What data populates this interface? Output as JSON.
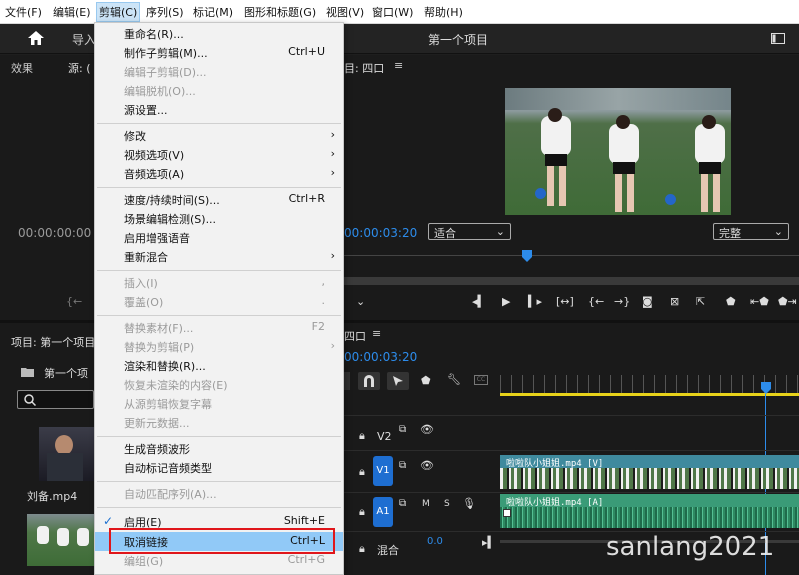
{
  "menubar": [
    "文件(F)",
    "编辑(E)",
    "剪辑(C)",
    "序列(S)",
    "标记(M)",
    "图形和标题(G)",
    "视图(V)",
    "窗口(W)",
    "帮助(H)"
  ],
  "topbar": {
    "import_label": "导入",
    "project_title": "第一个项目"
  },
  "panels": {
    "effects_label": "效果",
    "source_label": "源: (",
    "program_label": "目: 四口",
    "source_timecode": "00:00:00:00",
    "program_timecode": "00:00:03:20",
    "fit_label": "适合",
    "quality_label": "完整",
    "project_label": "项目: 第一个项目",
    "project_folder": "第一个项",
    "clip_name": "刘备.mp4",
    "timeline_seq": "四口",
    "timeline_timecode": "00:00:03:20"
  },
  "tracks": {
    "v2": "V2",
    "v1": "V1",
    "a1": "A1",
    "mix_label": "混合",
    "mix_value": "0.0",
    "m_label": "M",
    "s_label": "S",
    "video_clip": "啦啦队小姐姐.mp4 [V]",
    "audio_clip": "啦啦队小姐姐.mp4 [A]"
  },
  "menu": {
    "items": [
      {
        "label": "重命名(R)...",
        "shortcut": "",
        "disabled": false,
        "submenu": false
      },
      {
        "label": "制作子剪辑(M)...",
        "shortcut": "Ctrl+U",
        "disabled": false,
        "submenu": false
      },
      {
        "label": "编辑子剪辑(D)...",
        "shortcut": "",
        "disabled": true,
        "submenu": false
      },
      {
        "label": "编辑脱机(O)...",
        "shortcut": "",
        "disabled": true,
        "submenu": false
      },
      {
        "label": "源设置...",
        "shortcut": "",
        "disabled": false,
        "submenu": false
      },
      {
        "label": "修改",
        "shortcut": "",
        "disabled": false,
        "submenu": true
      },
      {
        "label": "视频选项(V)",
        "shortcut": "",
        "disabled": false,
        "submenu": true
      },
      {
        "label": "音频选项(A)",
        "shortcut": "",
        "disabled": false,
        "submenu": true
      },
      {
        "label": "速度/持续时间(S)...",
        "shortcut": "Ctrl+R",
        "disabled": false,
        "submenu": false
      },
      {
        "label": "场景编辑检测(S)...",
        "shortcut": "",
        "disabled": false,
        "submenu": false
      },
      {
        "label": "启用增强语音",
        "shortcut": "",
        "disabled": false,
        "submenu": false
      },
      {
        "label": "重新混合",
        "shortcut": "",
        "disabled": false,
        "submenu": true
      },
      {
        "label": "插入(I)",
        "shortcut": ",",
        "disabled": true,
        "submenu": false
      },
      {
        "label": "覆盖(O)",
        "shortcut": ".",
        "disabled": true,
        "submenu": false
      },
      {
        "label": "替换素材(F)...",
        "shortcut": "F2",
        "disabled": true,
        "submenu": false
      },
      {
        "label": "替换为剪辑(P)",
        "shortcut": "",
        "disabled": true,
        "submenu": true
      },
      {
        "label": "渲染和替换(R)...",
        "shortcut": "",
        "disabled": false,
        "submenu": false
      },
      {
        "label": "恢复未渲染的内容(E)",
        "shortcut": "",
        "disabled": true,
        "submenu": false
      },
      {
        "label": "从源剪辑恢复字幕",
        "shortcut": "",
        "disabled": true,
        "submenu": false
      },
      {
        "label": "更新元数据...",
        "shortcut": "",
        "disabled": true,
        "submenu": false
      },
      {
        "label": "生成音频波形",
        "shortcut": "",
        "disabled": false,
        "submenu": false
      },
      {
        "label": "自动标记音频类型",
        "shortcut": "",
        "disabled": false,
        "submenu": false
      },
      {
        "label": "自动匹配序列(A)...",
        "shortcut": "",
        "disabled": true,
        "submenu": false
      },
      {
        "label": "启用(E)",
        "shortcut": "Shift+E",
        "disabled": false,
        "submenu": false
      },
      {
        "label": "取消链接",
        "shortcut": "Ctrl+L",
        "disabled": false,
        "submenu": false
      },
      {
        "label": "编组(G)",
        "shortcut": "Ctrl+G",
        "disabled": true,
        "submenu": false
      }
    ]
  },
  "watermark": "sanlang2021"
}
